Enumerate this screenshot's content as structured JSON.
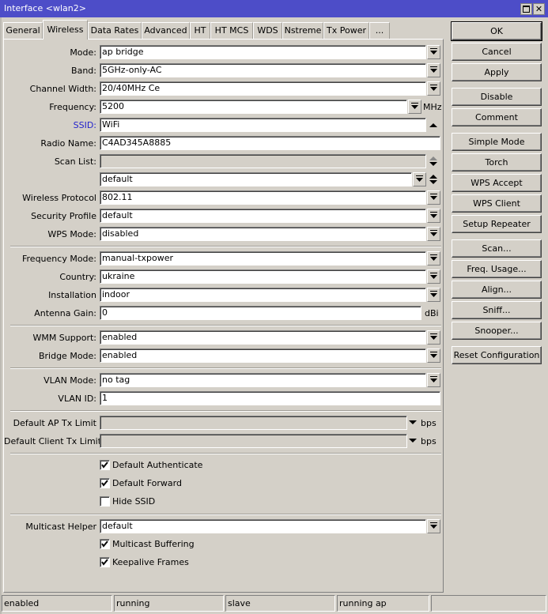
{
  "window": {
    "title": "Interface <wlan2>"
  },
  "tabs": [
    {
      "label": "General",
      "active": false
    },
    {
      "label": "Wireless",
      "active": true
    },
    {
      "label": "Data Rates",
      "active": false
    },
    {
      "label": "Advanced",
      "active": false
    },
    {
      "label": "HT",
      "active": false
    },
    {
      "label": "HT MCS",
      "active": false
    },
    {
      "label": "WDS",
      "active": false
    },
    {
      "label": "Nstreme",
      "active": false
    },
    {
      "label": "Tx Power",
      "active": false
    },
    {
      "label": "...",
      "active": false
    }
  ],
  "form": {
    "mode": {
      "label": "Mode:",
      "value": "ap bridge"
    },
    "band": {
      "label": "Band:",
      "value": "5GHz-only-AC"
    },
    "channel_width": {
      "label": "Channel Width:",
      "value": "20/40MHz Ce"
    },
    "frequency": {
      "label": "Frequency:",
      "value": "5200",
      "unit": "MHz"
    },
    "ssid": {
      "label": "SSID:",
      "value": "WiFi"
    },
    "radio_name": {
      "label": "Radio Name:",
      "value": "C4AD345A8885"
    },
    "scan_list": {
      "label": "Scan List:",
      "value": "",
      "value2": "default"
    },
    "wireless_protocol": {
      "label": "Wireless Protocol",
      "value": "802.11"
    },
    "security_profile": {
      "label": "Security Profile",
      "value": "default"
    },
    "wps_mode": {
      "label": "WPS Mode:",
      "value": "disabled"
    },
    "frequency_mode": {
      "label": "Frequency Mode:",
      "value": "manual-txpower"
    },
    "country": {
      "label": "Country:",
      "value": "ukraine"
    },
    "installation": {
      "label": "Installation",
      "value": "indoor"
    },
    "antenna_gain": {
      "label": "Antenna Gain:",
      "value": "0",
      "unit": "dBi"
    },
    "wmm_support": {
      "label": "WMM Support:",
      "value": "enabled"
    },
    "bridge_mode": {
      "label": "Bridge Mode:",
      "value": "enabled"
    },
    "vlan_mode": {
      "label": "VLAN Mode:",
      "value": "no tag"
    },
    "vlan_id": {
      "label": "VLAN ID:",
      "value": "1"
    },
    "default_ap_tx_limit": {
      "label": "Default AP Tx Limit",
      "value": "",
      "unit": "bps"
    },
    "default_client_tx_limit": {
      "label": "Default Client Tx Limit",
      "value": "",
      "unit": "bps"
    },
    "default_authenticate": {
      "label": "Default Authenticate",
      "checked": true
    },
    "default_forward": {
      "label": "Default Forward",
      "checked": true
    },
    "hide_ssid": {
      "label": "Hide SSID",
      "checked": false
    },
    "multicast_helper": {
      "label": "Multicast Helper",
      "value": "default"
    },
    "multicast_buffering": {
      "label": "Multicast Buffering",
      "checked": true
    },
    "keepalive_frames": {
      "label": "Keepalive Frames",
      "checked": true
    }
  },
  "buttons": {
    "ok": "OK",
    "cancel": "Cancel",
    "apply": "Apply",
    "disable": "Disable",
    "comment": "Comment",
    "simple_mode": "Simple Mode",
    "torch": "Torch",
    "wps_accept": "WPS Accept",
    "wps_client": "WPS Client",
    "setup_repeater": "Setup Repeater",
    "scan": "Scan...",
    "freq_usage": "Freq. Usage...",
    "align": "Align...",
    "sniff": "Sniff...",
    "snooper": "Snooper...",
    "reset_configuration": "Reset Configuration"
  },
  "status": [
    "enabled",
    "running",
    "slave",
    "running ap",
    ""
  ]
}
